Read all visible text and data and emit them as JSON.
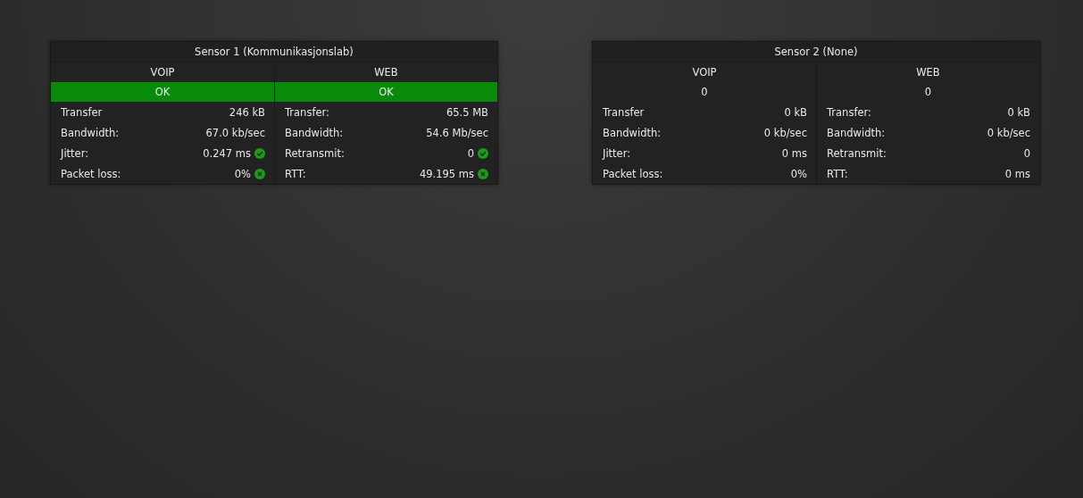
{
  "sensors": [
    {
      "title": "Sensor 1 (Kommunikasjonslab)",
      "channels": [
        {
          "name": "VOIP",
          "status": "OK",
          "ok": true,
          "rows": [
            {
              "label": "Transfer",
              "value": "246 kB",
              "kind": "plain"
            },
            {
              "label": "Bandwidth:",
              "value": "67.0 kb/sec",
              "kind": "plain"
            },
            {
              "label": "Jitter:",
              "value": "0.247 ms",
              "kind": "check"
            },
            {
              "label": "Packet loss:",
              "value": "0%",
              "kind": "cross"
            }
          ]
        },
        {
          "name": "WEB",
          "status": "OK",
          "ok": true,
          "rows": [
            {
              "label": "Transfer:",
              "value": "65.5 MB",
              "kind": "plain"
            },
            {
              "label": "Bandwidth:",
              "value": "54.6 Mb/sec",
              "kind": "plain"
            },
            {
              "label": "Retransmit:",
              "value": "0",
              "kind": "check"
            },
            {
              "label": "RTT:",
              "value": "49.195 ms",
              "kind": "cross"
            }
          ]
        }
      ]
    },
    {
      "title": "Sensor 2 (None)",
      "channels": [
        {
          "name": "VOIP",
          "status": "0",
          "ok": false,
          "rows": [
            {
              "label": "Transfer",
              "value": "0 kB",
              "kind": "plain"
            },
            {
              "label": "Bandwidth:",
              "value": "0 kb/sec",
              "kind": "plain"
            },
            {
              "label": "Jitter:",
              "value": "0 ms",
              "kind": "plain"
            },
            {
              "label": "Packet loss:",
              "value": "0%",
              "kind": "plain"
            }
          ]
        },
        {
          "name": "WEB",
          "status": "0",
          "ok": false,
          "rows": [
            {
              "label": "Transfer:",
              "value": "0 kB",
              "kind": "plain"
            },
            {
              "label": "Bandwidth:",
              "value": "0 kb/sec",
              "kind": "plain"
            },
            {
              "label": "Retransmit:",
              "value": "0",
              "kind": "plain"
            },
            {
              "label": "RTT:",
              "value": "0 ms",
              "kind": "plain"
            }
          ]
        }
      ]
    }
  ]
}
